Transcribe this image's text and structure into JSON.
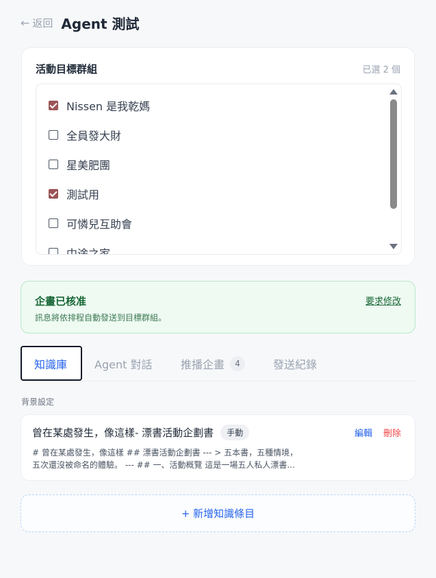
{
  "header": {
    "back_arrow": "←",
    "back_label": "返回",
    "title": "Agent 測試"
  },
  "groups": {
    "title": "活動目標群組",
    "selected_count": "已選 2 個",
    "items": [
      {
        "label": "Nissen 是我乾媽",
        "checked": true
      },
      {
        "label": "全員發大財",
        "checked": false
      },
      {
        "label": "星美肥團",
        "checked": false
      },
      {
        "label": "測試用",
        "checked": true
      },
      {
        "label": "可憐兒互助會",
        "checked": false
      },
      {
        "label": "中途之家",
        "checked": false
      }
    ]
  },
  "approval": {
    "title": "企畫已核准",
    "description": "訊息將依排程自動發送到目標群組。",
    "revise_label": "要求修改"
  },
  "tabs": [
    {
      "label": "知識庫",
      "active": true
    },
    {
      "label": "Agent 對話",
      "active": false
    },
    {
      "label": "推播企畫",
      "badge": "4",
      "active": false
    },
    {
      "label": "發送紀錄",
      "active": false
    }
  ],
  "knowledge": {
    "section_label": "背景設定",
    "items": [
      {
        "title": "曾在某處發生，像這樣- 漂書活動企劃書",
        "tag": "手動",
        "edit_label": "編輯",
        "delete_label": "刪除",
        "preview_line1": "# 曾在某處發生，像這樣 ## 漂書活動企劃書 --- > 五本書，五種情境，",
        "preview_line2": "五次還沒被命名的體驗。 --- ## 一、活動概覽 這是一場五人私人漂書..."
      }
    ],
    "add_label": "+ 新增知識條目"
  },
  "colors": {
    "accent": "#2563eb",
    "checkbox_checked": "#9b5356",
    "approved_bg": "#eefaf2",
    "approved_text": "#166534",
    "danger": "#ef4444"
  }
}
